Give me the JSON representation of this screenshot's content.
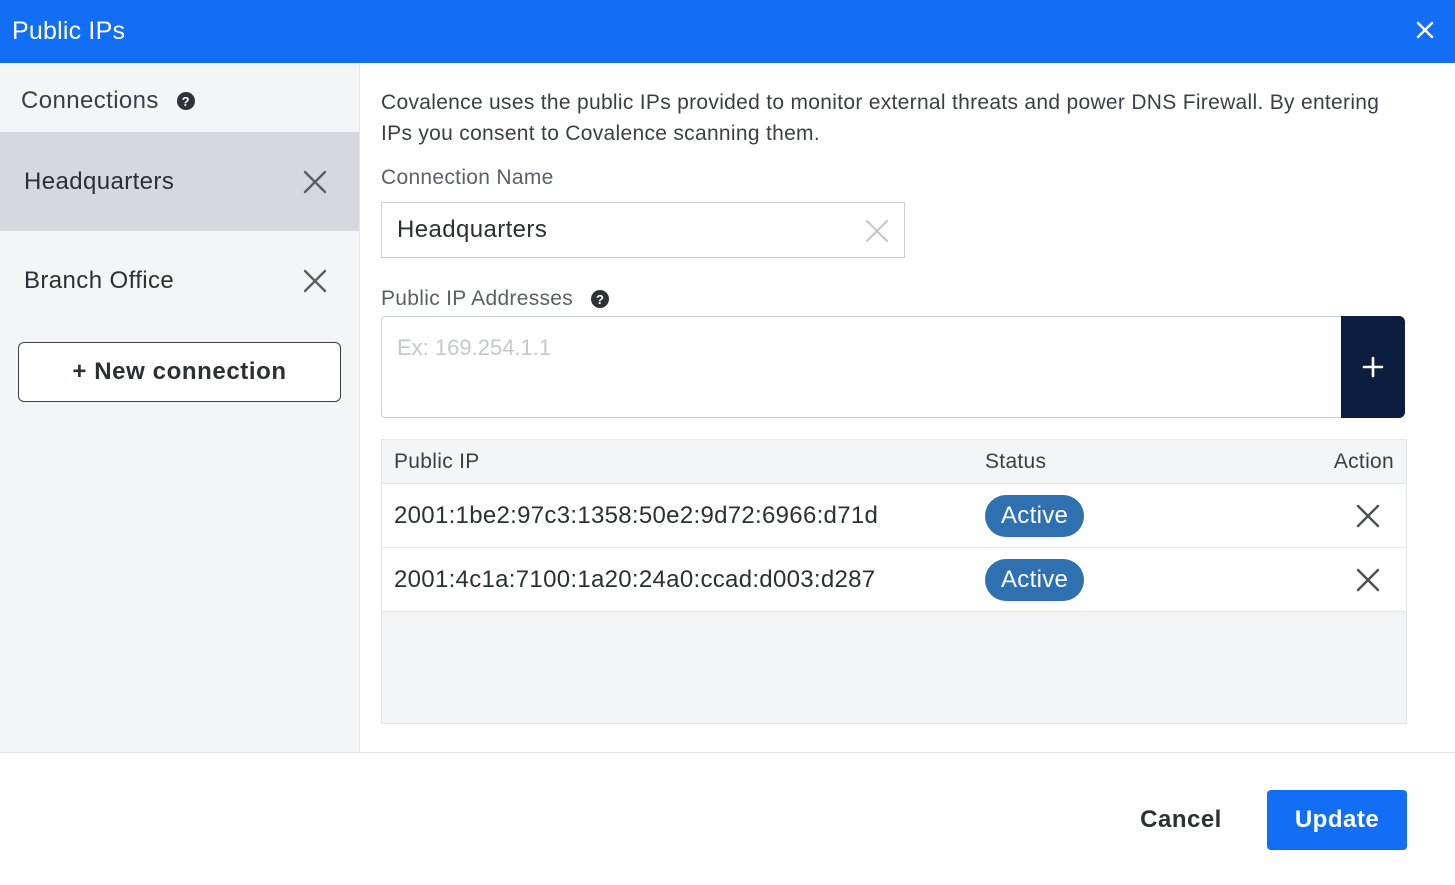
{
  "dialog": {
    "title": "Public IPs",
    "close_icon": "close-icon"
  },
  "sidebar": {
    "heading": "Connections",
    "help": "?",
    "connections": [
      {
        "label": "Headquarters",
        "selected": true
      },
      {
        "label": "Branch Office",
        "selected": false
      }
    ],
    "new_connection_label": "+ New connection"
  },
  "main": {
    "description": "Covalence uses the public IPs provided to monitor external threats and power DNS Firewall. By entering IPs you consent to Covalence scanning them.",
    "connection_name_label": "Connection Name",
    "connection_name_value": "Headquarters",
    "public_ip_label": "Public IP Addresses",
    "public_ip_placeholder": "Ex: 169.254.1.1",
    "add_label": "+"
  },
  "table": {
    "headers": [
      "Public IP",
      "Status",
      "Action"
    ],
    "rows": [
      {
        "ip": "2001:1be2:97c3:1358:50e2:9d72:6966:d71d",
        "status": "Active"
      },
      {
        "ip": "2001:4c1a:7100:1a20:24a0:ccad:d003:d287",
        "status": "Active"
      }
    ]
  },
  "footer": {
    "cancel_label": "Cancel",
    "update_label": "Update"
  },
  "colors": {
    "accent": "#136ef6",
    "dark_button": "#0c1d40",
    "status_active": "#2f71b0"
  }
}
